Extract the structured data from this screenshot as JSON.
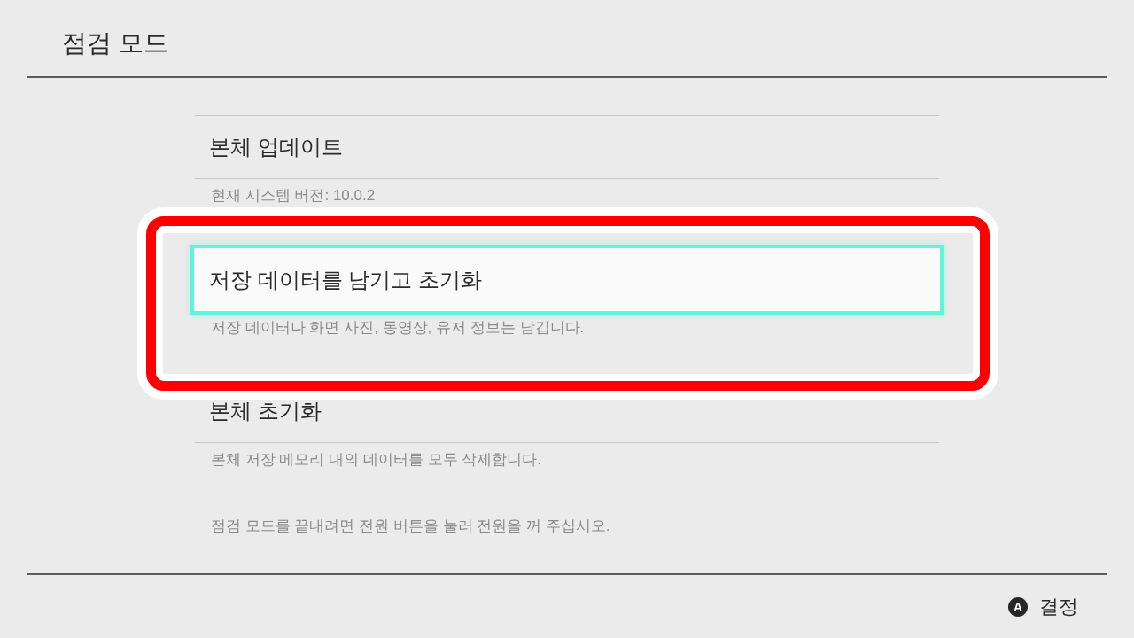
{
  "header": {
    "title": "점검 모드"
  },
  "menu": {
    "items": [
      {
        "title": "본체 업데이트",
        "description": "현재 시스템 버전: 10.0.2",
        "selected": false
      },
      {
        "title": "저장 데이터를 남기고 초기화",
        "description": "저장 데이터나 화면 사진, 동영상, 유저 정보는 남깁니다.",
        "selected": true
      },
      {
        "title": "본체 초기화",
        "description": "본체 저장 메모리 내의 데이터를 모두 삭제합니다.",
        "selected": false
      }
    ]
  },
  "note": "점검 모드를 끝내려면 전원 버튼을 눌러 전원을 꺼 주십시오.",
  "footer": {
    "actions": [
      {
        "button": "A",
        "label": "결정"
      }
    ]
  }
}
